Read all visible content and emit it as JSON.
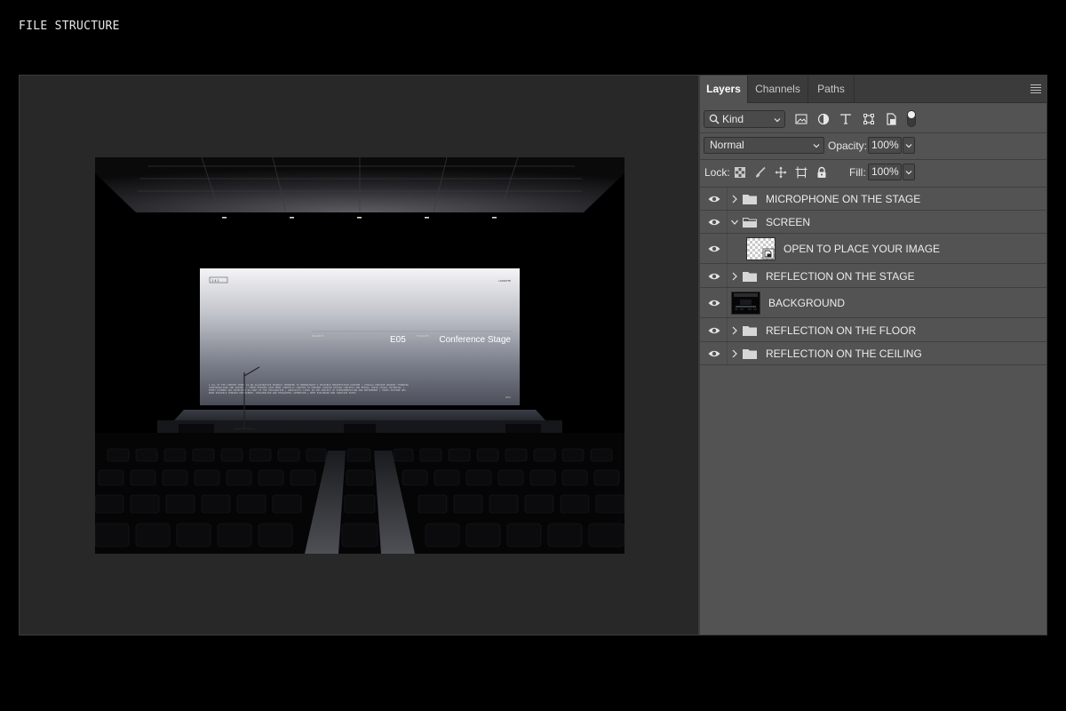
{
  "heading": "FILE STRUCTURE",
  "artwork": {
    "screen_tag": "1  4  1",
    "screen_corner": "LUMATTE",
    "screen_left_small": "BRANDIT",
    "screen_mid_small": "TONIGHT",
    "screen_code": "E05",
    "screen_title": "Conference Stage",
    "screen_page": "001",
    "screen_footer": "1 ALL OF THE CONTENT SHOWN IS AN ILLUSTRATIVE EXAMPLE INTENDED TO DEMONSTRATE A POSSIBLE PRESENTATION OUTCOME | VISUALS PROVIDE GRAPHIC THINKING CONSIDERATIONS AND ADVANCE | THESE MOCKUPS HAVE BEEN CAREFULLY CRAFTED TO PRESENT VARIOUS DESIGN CONCEPTS AND REVEAL THEIR VISUAL POTENTIAL | EVERY ELEMENT WAS DEVELOPED AS PART OF THE EXPLORATION | CREATIVITY LIVES IN THE PROCESS OF EXPERIMENTATION AND REFINEMENT | EVERY OUTCOME WAS MADE POSSIBLE THROUGH EXPERIENCE, IMAGINATION AND THOUGHTFUL INTENTION | KEEP EXPLORING NEW CREATIVE PATHS"
  },
  "panel": {
    "tabs": [
      "Layers",
      "Channels",
      "Paths"
    ],
    "active_tab": "Layers",
    "filter": {
      "kind_label": "Kind"
    },
    "blend_mode": "Normal",
    "opacity_label": "Opacity:",
    "opacity_value": "100%",
    "lock_label": "Lock:",
    "fill_label": "Fill:",
    "fill_value": "100%",
    "layers": [
      {
        "name": "MICROPHONE ON THE STAGE",
        "type": "group",
        "expanded": false,
        "visible": true
      },
      {
        "name": "SCREEN",
        "type": "group",
        "expanded": true,
        "visible": true
      },
      {
        "name": "OPEN TO PLACE YOUR IMAGE",
        "type": "smart-object",
        "visible": true
      },
      {
        "name": "REFLECTION ON THE STAGE",
        "type": "group",
        "expanded": false,
        "visible": true
      },
      {
        "name": "BACKGROUND",
        "type": "layer",
        "visible": true
      },
      {
        "name": "REFLECTION ON THE FLOOR",
        "type": "group",
        "expanded": false,
        "visible": true
      },
      {
        "name": "REFLECTION ON THE CEILING",
        "type": "group",
        "expanded": false,
        "visible": true
      }
    ]
  },
  "colors": {
    "page_bg": "#000000",
    "canvas_bg": "#282828",
    "panel_bg": "#535353",
    "tabbar_bg": "#3b3b3b",
    "text": "#e6e6e6"
  }
}
